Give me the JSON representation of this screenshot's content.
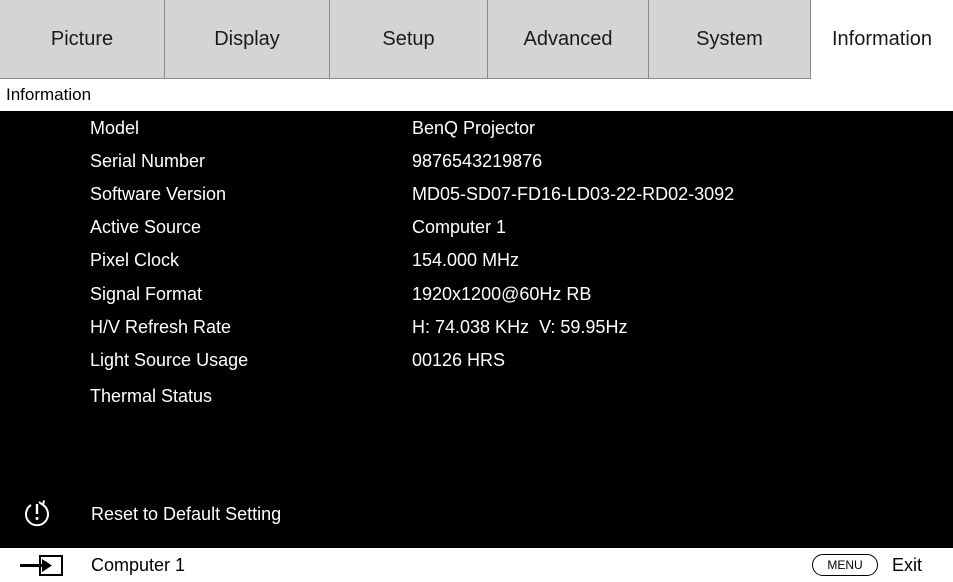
{
  "tabs": [
    {
      "label": "Picture",
      "active": false
    },
    {
      "label": "Display",
      "active": false
    },
    {
      "label": "Setup",
      "active": false
    },
    {
      "label": "Advanced",
      "active": false
    },
    {
      "label": "System",
      "active": false
    },
    {
      "label": "Information",
      "active": true
    }
  ],
  "breadcrumb": "Information",
  "info": [
    {
      "label": "Model",
      "value": "BenQ Projector"
    },
    {
      "label": "Serial Number",
      "value": "9876543219876"
    },
    {
      "label": "Software Version",
      "value": "MD05-SD07-FD16-LD03-22-RD02-3092"
    },
    {
      "label": "Active Source",
      "value": "Computer 1"
    },
    {
      "label": "Pixel Clock",
      "value": "154.000 MHz"
    },
    {
      "label": "Signal Format",
      "value": "1920x1200@60Hz RB"
    },
    {
      "label": "H/V Refresh Rate",
      "value": "H: 74.038 KHz  V: 59.95Hz"
    },
    {
      "label": "Light Source Usage",
      "value": "00126 HRS"
    },
    {
      "label": "Thermal Status",
      "value": ""
    }
  ],
  "reset": {
    "label": "Reset to Default Setting",
    "icon": "reset-power-icon"
  },
  "footer": {
    "source_icon": "input-source-icon",
    "source_label": "Computer 1",
    "menu_button": "MENU",
    "exit_label": "Exit"
  },
  "colors": {
    "tab_bg": "#d4d4d4",
    "panel_bg": "#000000",
    "text_on_panel": "#ffffff"
  }
}
